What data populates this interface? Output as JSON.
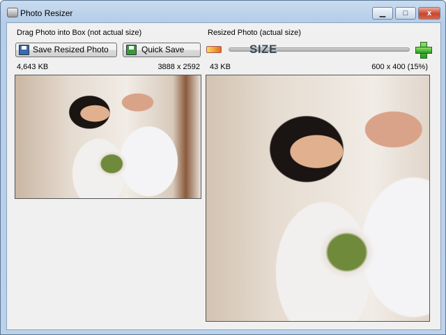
{
  "window": {
    "title": "Photo Resizer",
    "minimize": "▁",
    "maximize": "□",
    "close": "x"
  },
  "left": {
    "heading": "Drag Photo into Box (not actual size)",
    "save_resized_label": "Save Resized Photo",
    "file_size": "4,643 KB",
    "dimensions": "3888 x 2592"
  },
  "right": {
    "heading": "Resized Photo (actual size)",
    "quick_save_label": "Quick Save",
    "slider_label": "SIZE",
    "slider_percent": 15,
    "file_size": "43 KB",
    "dimensions": "600 x 400 (15%)"
  }
}
